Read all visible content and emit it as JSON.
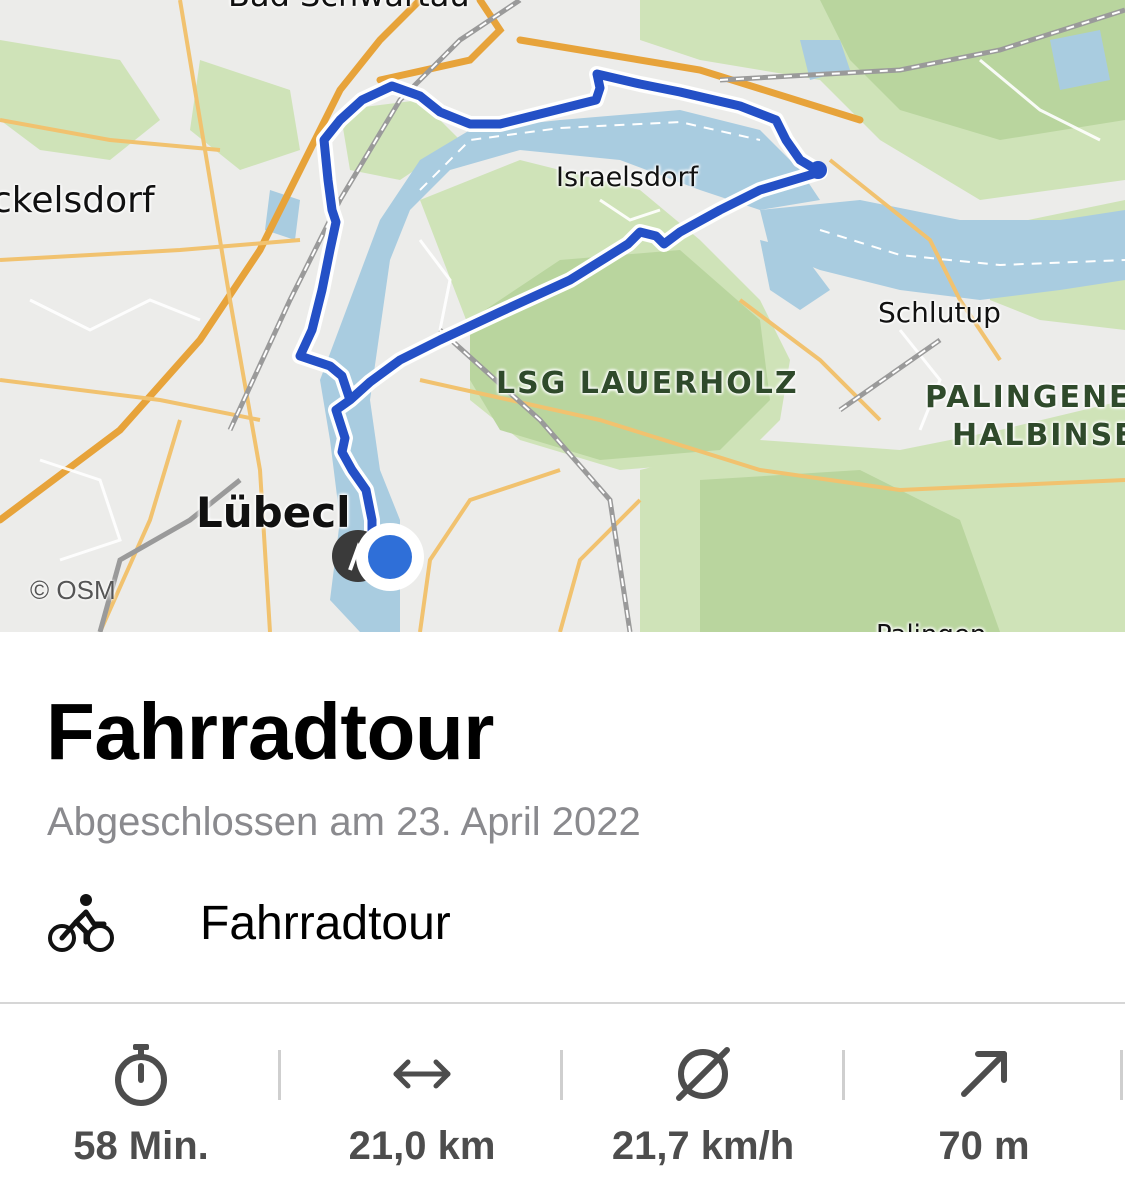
{
  "map": {
    "labels": {
      "bad_schwartau": "Bad Schwartau",
      "ckelsdorf": "ckelsdorf",
      "israelsdorf": "Israelsdorf",
      "schlutup": "Schlutup",
      "lsg_lauerholz": "LSG LAUERHOLZ",
      "palingen_line1": "PALINGENE",
      "palingen_line2": "HALBINSE",
      "luebeck": "Lübecl",
      "palingen_bottom": "Palingen"
    },
    "credit": "© OSM",
    "route_color": "#2450c6",
    "location_dot_color": "#2f6fd8",
    "icons": [
      "location-dot-icon",
      "map-pin-icon"
    ]
  },
  "detail": {
    "title": "Fahrradtour",
    "subtitle": "Abgeschlossen am 23. April 2022",
    "activity": {
      "icon": "cyclist-icon",
      "label": "Fahrradtour"
    }
  },
  "stats": [
    {
      "icon": "stopwatch-icon",
      "value": "58 Min."
    },
    {
      "icon": "distance-arrows-icon",
      "value": "21,0 km"
    },
    {
      "icon": "average-icon",
      "value": "21,7 km/h"
    },
    {
      "icon": "elevation-arrow-icon",
      "value": "70 m"
    }
  ]
}
